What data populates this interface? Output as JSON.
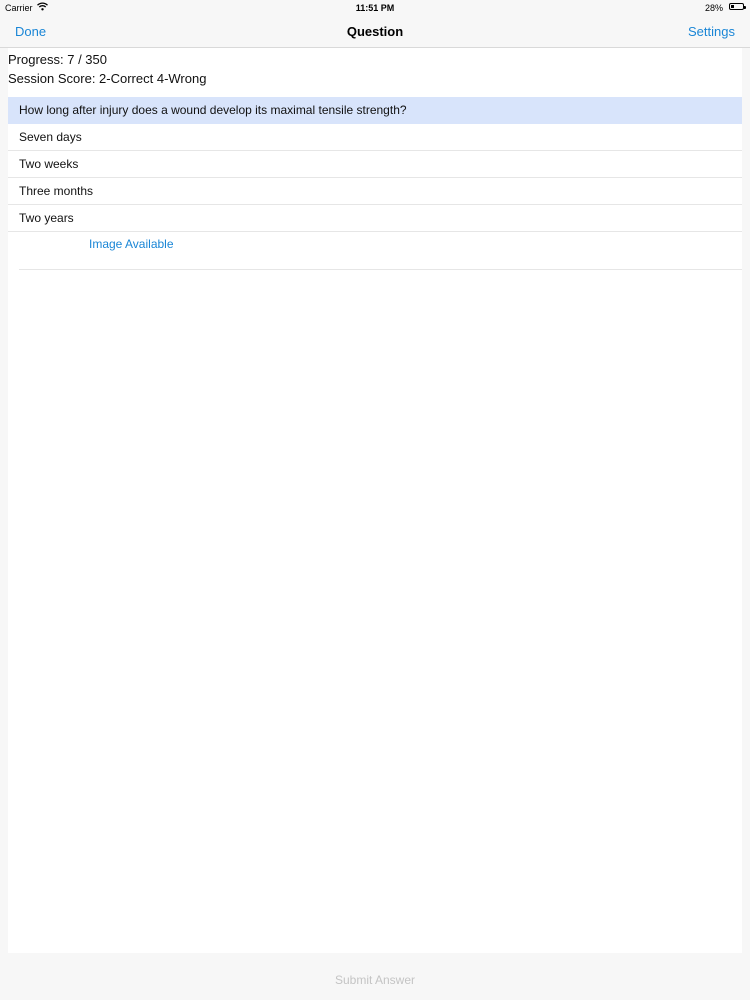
{
  "status_bar": {
    "carrier": "Carrier",
    "wifi_icon": "wifi-icon",
    "time": "11:51 PM",
    "battery_percent": "28%",
    "battery_icon": "battery-icon",
    "battery_level": 0.28
  },
  "nav": {
    "left_label": "Done",
    "title": "Question",
    "right_label": "Settings",
    "accent_color": "#1a86d6"
  },
  "session": {
    "progress": "Progress: 7 / 350",
    "score": "Session Score: 2-Correct 4-Wrong"
  },
  "question": {
    "text": "How long after injury does a wound develop its maximal tensile strength?",
    "highlight_color": "#d8e4fb"
  },
  "answers": [
    "Seven days",
    "Two weeks",
    "Three months",
    "Two years"
  ],
  "image_link": "Image Available",
  "footer": {
    "submit_label": "Submit Answer",
    "disabled_color": "#c4c4c4"
  }
}
